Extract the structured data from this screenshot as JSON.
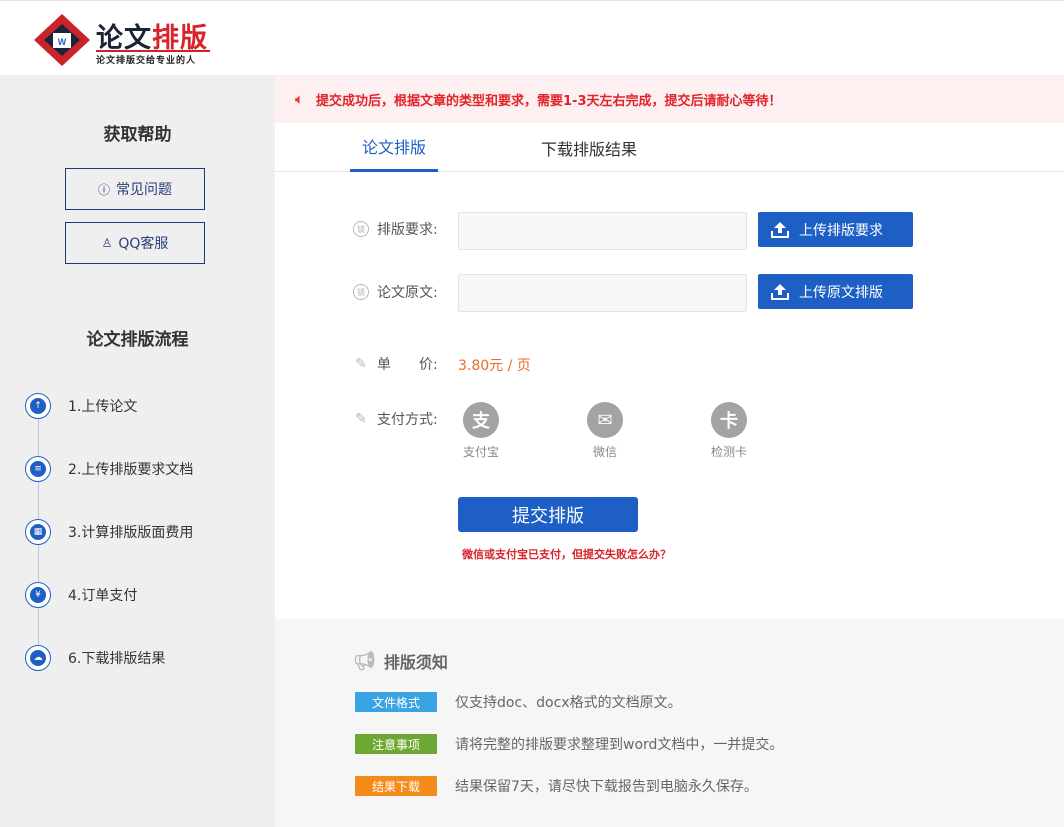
{
  "header": {
    "logo_title_part1": "论文",
    "logo_title_part2": "排版",
    "logo_slogan": "论文排版交给专业的人"
  },
  "sidebar": {
    "help_title": "获取帮助",
    "faq_button": "常见问题",
    "qq_button": "QQ客服",
    "flow_title": "论文排版流程",
    "steps": [
      {
        "label": "1.上传论文",
        "icon": "upload-icon"
      },
      {
        "label": "2.上传排版要求文档",
        "icon": "document-icon"
      },
      {
        "label": "3.计算排版版面费用",
        "icon": "calculator-icon"
      },
      {
        "label": "4.订单支付",
        "icon": "yen-icon"
      },
      {
        "label": "6.下载排版结果",
        "icon": "cloud-download-icon"
      }
    ]
  },
  "notice": {
    "text": "提交成功后，根据文章的类型和要求，需要1-3天左右完成，提交后请耐心等待！"
  },
  "tabs": [
    {
      "label": "论文排版",
      "active": true
    },
    {
      "label": "下载排版结果",
      "active": false
    }
  ],
  "form": {
    "requirement_label": "排版要求:",
    "requirement_value": "",
    "requirement_upload": "上传排版要求",
    "original_label": "论文原文:",
    "original_value": "",
    "original_upload": "上传原文排版",
    "price_label": "单　　价:",
    "price_value": "3.80元 / 页",
    "payment_label": "支付方式:",
    "payment_options": [
      {
        "glyph": "支",
        "label": "支付宝"
      },
      {
        "glyph": "✉",
        "label": "微信"
      },
      {
        "glyph": "卡",
        "label": "检测卡"
      }
    ],
    "submit": "提交排版",
    "fail_link": "微信或支付宝已支付，但提交失败怎么办？"
  },
  "notes": {
    "title": "排版须知",
    "items": [
      {
        "tag": "文件格式",
        "color": "#3aa3e3",
        "text": "仅支持doc、docx格式的文档原文。"
      },
      {
        "tag": "注意事项",
        "color": "#6ca832",
        "text": "请将完整的排版要求整理到word文档中，一并提交。"
      },
      {
        "tag": "结果下载",
        "color": "#f38b1a",
        "text": "结果保留7天，请尽快下载报告到电脑永久保存。"
      }
    ]
  },
  "colors": {
    "primary": "#1d5fc5",
    "notice_bg": "#feeff0",
    "notice_text": "#e0242a",
    "price": "#ef6a2a"
  }
}
